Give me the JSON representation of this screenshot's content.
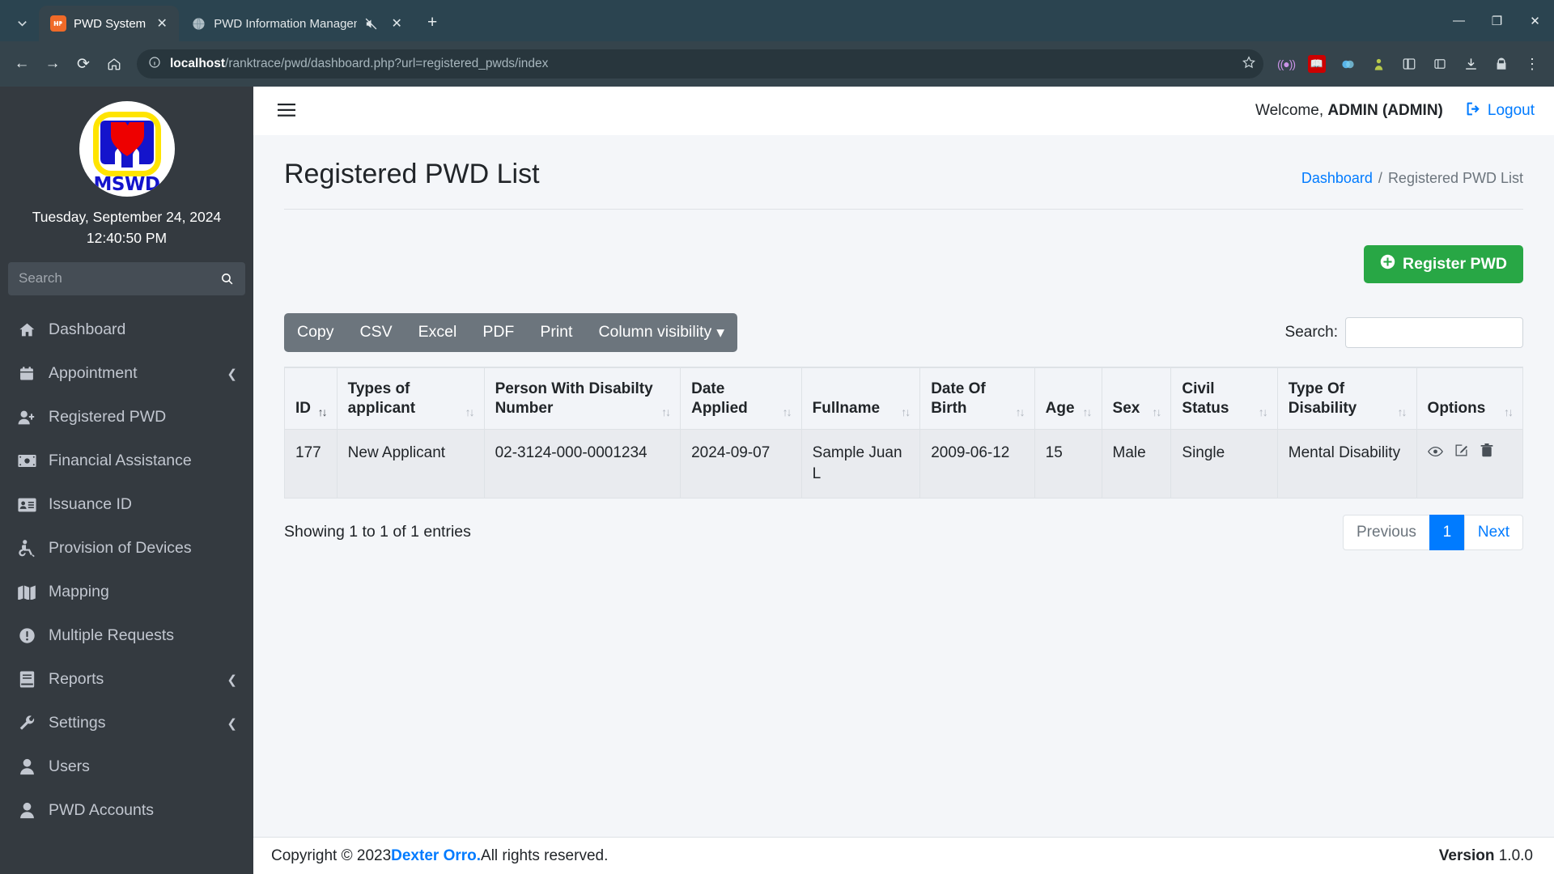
{
  "browser": {
    "tab_search_icon": "chevron-down-icon",
    "tabs": [
      {
        "title": "PWD System",
        "favicon": "pwd-favicon",
        "active": true,
        "close_label": "✕"
      },
      {
        "title": "PWD Information Managem",
        "favicon": "globe-icon",
        "active": false,
        "muted": true,
        "close_label": "✕"
      }
    ],
    "new_tab_label": "+",
    "window_controls": {
      "minimize": "—",
      "maximize": "❐",
      "close": "✕"
    },
    "nav": {
      "back": "←",
      "forward": "→",
      "reload": "⟳",
      "home": "⌂"
    },
    "omnibox": {
      "info_icon": "info-circle-icon",
      "url_host": "localhost",
      "url_path": "/ranktrace/pwd/dashboard.php?url=registered_pwds/index",
      "bookmark_icon": "star-outline-icon"
    },
    "toolbar_icons": [
      "cast-icon",
      "pdf-extension-icon",
      "extension-chromatic-icon",
      "extension-green-icon",
      "split-view-icon",
      "collections-icon",
      "download-icon",
      "security-icon",
      "chrome-menu-icon"
    ]
  },
  "sidebar": {
    "logo": {
      "name": "mswd-logo",
      "text": "MSWD"
    },
    "date": "Tuesday, September 24, 2024",
    "time": "12:40:50 PM",
    "search": {
      "placeholder": "Search",
      "value": "",
      "icon": "search-icon"
    },
    "items": [
      {
        "label": "Dashboard",
        "icon": "home-icon",
        "caret": false
      },
      {
        "label": "Appointment",
        "icon": "calendar-icon",
        "caret": true
      },
      {
        "label": "Registered PWD",
        "icon": "user-plus-icon",
        "caret": false
      },
      {
        "label": "Financial Assistance",
        "icon": "money-bill-icon",
        "caret": false
      },
      {
        "label": "Issuance ID",
        "icon": "id-card-icon",
        "caret": false
      },
      {
        "label": "Provision of Devices",
        "icon": "wheelchair-icon",
        "caret": false
      },
      {
        "label": "Mapping",
        "icon": "map-icon",
        "caret": false
      },
      {
        "label": "Multiple Requests",
        "icon": "exclamation-circle-icon",
        "caret": false
      },
      {
        "label": "Reports",
        "icon": "book-icon",
        "caret": true
      },
      {
        "label": "Settings",
        "icon": "wrench-icon",
        "caret": true
      },
      {
        "label": "Users",
        "icon": "user-icon",
        "caret": false
      },
      {
        "label": "PWD Accounts",
        "icon": "user-circle-icon",
        "caret": false
      }
    ]
  },
  "topbar": {
    "hamburger_icon": "bars-icon",
    "welcome_prefix": "Welcome, ",
    "welcome_user": "ADMIN (ADMIN)",
    "logout_label": "Logout",
    "logout_icon": "sign-out-icon"
  },
  "page": {
    "title": "Registered PWD List",
    "breadcrumb": {
      "root": "Dashboard",
      "separator": "/",
      "current": "Registered PWD List"
    },
    "register_button": {
      "label": "Register PWD",
      "icon": "plus-circle-icon",
      "color": "#28a745"
    }
  },
  "datatable": {
    "buttons": [
      {
        "label": "Copy"
      },
      {
        "label": "CSV"
      },
      {
        "label": "Excel"
      },
      {
        "label": "PDF"
      },
      {
        "label": "Print"
      },
      {
        "label": "Column visibility",
        "caret": "▾"
      }
    ],
    "search": {
      "label": "Search:",
      "value": "",
      "placeholder": ""
    },
    "columns": [
      {
        "label": "ID",
        "sort": "asc"
      },
      {
        "label": "Types of applicant",
        "sort": "none"
      },
      {
        "label": "Person With Disabilty Number",
        "sort": "none"
      },
      {
        "label": "Date Applied",
        "sort": "none"
      },
      {
        "label": "Fullname",
        "sort": "none"
      },
      {
        "label": "Date Of Birth",
        "sort": "none"
      },
      {
        "label": "Age",
        "sort": "none"
      },
      {
        "label": "Sex",
        "sort": "none"
      },
      {
        "label": "Civil Status",
        "sort": "none"
      },
      {
        "label": "Type Of Disability",
        "sort": "none"
      },
      {
        "label": "Options",
        "sort": "none"
      }
    ],
    "rows": [
      {
        "id": "177",
        "type_of_applicant": "New Applicant",
        "pwd_number": "02-3124-000-0001234",
        "date_applied": "2024-09-07",
        "fullname": "Sample Juan L",
        "date_of_birth": "2009-06-12",
        "age": "15",
        "sex": "Male",
        "civil_status": "Single",
        "type_of_disability": "Mental Disability",
        "options": [
          "view-icon",
          "edit-icon",
          "delete-icon"
        ]
      }
    ],
    "info": "Showing 1 to 1 of 1 entries",
    "pagination": {
      "previous": "Previous",
      "pages": [
        "1"
      ],
      "current": "1",
      "next": "Next"
    }
  },
  "footer": {
    "copyright_prefix": "Copyright © 2023 ",
    "author": "Dexter Orro.",
    "rights": " All rights reserved.",
    "version_label": "Version",
    "version_value": "1.0.0"
  }
}
